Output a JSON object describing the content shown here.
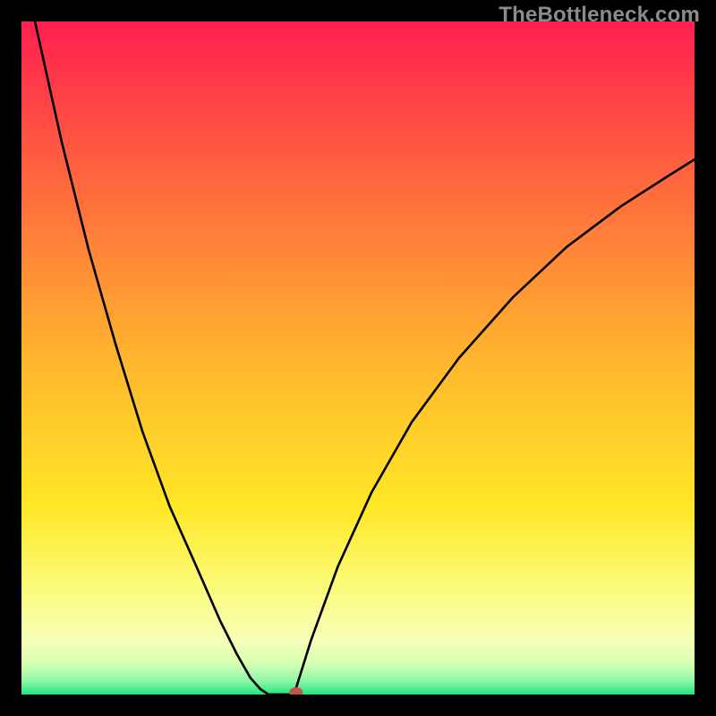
{
  "watermark": "TheBottleneck.com",
  "chart_data": {
    "type": "line",
    "title": "",
    "xlabel": "",
    "ylabel": "",
    "xlim": [
      0,
      1
    ],
    "ylim": [
      0,
      1
    ],
    "background_gradient": {
      "stops": [
        {
          "offset": 0.0,
          "color": "#ff1f4f"
        },
        {
          "offset": 0.25,
          "color": "#ff6b3d"
        },
        {
          "offset": 0.5,
          "color": "#ffb52e"
        },
        {
          "offset": 0.72,
          "color": "#ffe726"
        },
        {
          "offset": 0.84,
          "color": "#fbfb7a"
        },
        {
          "offset": 0.92,
          "color": "#f7ffb8"
        },
        {
          "offset": 0.955,
          "color": "#d4ffb3"
        },
        {
          "offset": 0.98,
          "color": "#8ef7a8"
        },
        {
          "offset": 1.0,
          "color": "#1fe67d"
        }
      ]
    },
    "series": [
      {
        "name": "left-branch",
        "x": [
          0.02,
          0.06,
          0.1,
          0.14,
          0.18,
          0.22,
          0.26,
          0.295,
          0.32,
          0.34,
          0.355,
          0.367
        ],
        "y": [
          1.0,
          0.82,
          0.66,
          0.52,
          0.39,
          0.28,
          0.19,
          0.11,
          0.06,
          0.025,
          0.008,
          0.0
        ]
      },
      {
        "name": "flat-bottom",
        "x": [
          0.367,
          0.405
        ],
        "y": [
          0.0,
          0.0
        ]
      },
      {
        "name": "right-branch",
        "x": [
          0.405,
          0.43,
          0.47,
          0.52,
          0.58,
          0.65,
          0.73,
          0.81,
          0.89,
          0.96,
          1.0
        ],
        "y": [
          0.0,
          0.08,
          0.19,
          0.3,
          0.405,
          0.5,
          0.59,
          0.665,
          0.725,
          0.77,
          0.795
        ]
      }
    ],
    "marker": {
      "x": 0.408,
      "y": 0.003,
      "color": "#c0564b",
      "rx": 0.01,
      "ry": 0.008
    }
  }
}
